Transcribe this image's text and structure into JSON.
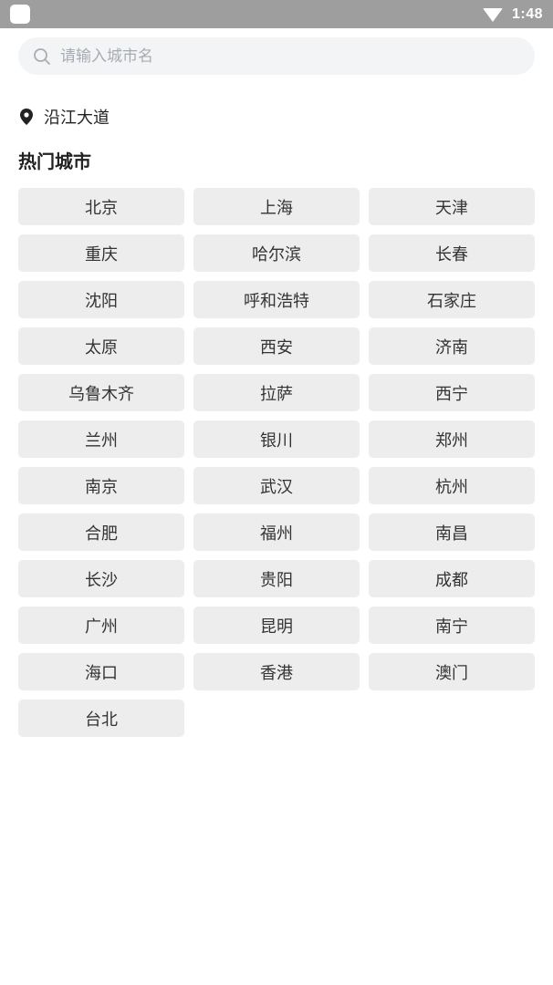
{
  "status_bar": {
    "time": "1:48",
    "icons": [
      "app-icon",
      "wifi-icon"
    ]
  },
  "search": {
    "placeholder": "请输入城市名",
    "value": "",
    "icon": "search-icon"
  },
  "location": {
    "icon": "pin-icon",
    "text": "沿江大道"
  },
  "hot_cities": {
    "title": "热门城市",
    "cities": [
      "北京",
      "上海",
      "天津",
      "重庆",
      "哈尔滨",
      "长春",
      "沈阳",
      "呼和浩特",
      "石家庄",
      "太原",
      "西安",
      "济南",
      "乌鲁木齐",
      "拉萨",
      "西宁",
      "兰州",
      "银川",
      "郑州",
      "南京",
      "武汉",
      "杭州",
      "合肥",
      "福州",
      "南昌",
      "长沙",
      "贵阳",
      "成都",
      "广州",
      "昆明",
      "南宁",
      "海口",
      "香港",
      "澳门",
      "台北"
    ]
  }
}
